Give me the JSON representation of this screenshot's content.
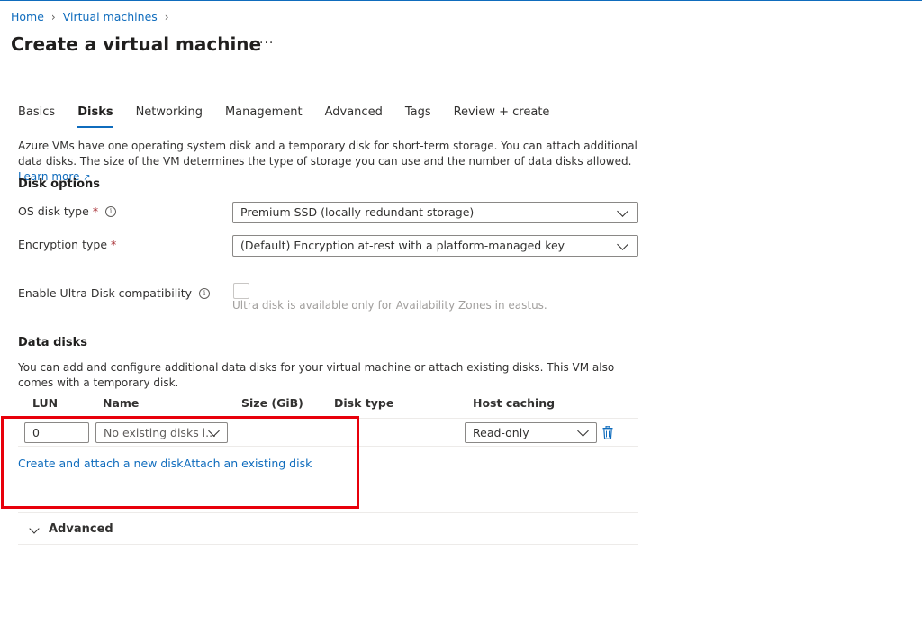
{
  "breadcrumb": {
    "home": "Home",
    "vm": "Virtual machines"
  },
  "page": {
    "title": "Create a virtual machine",
    "more": "···"
  },
  "tabs": [
    {
      "label": "Basics"
    },
    {
      "label": "Disks"
    },
    {
      "label": "Networking"
    },
    {
      "label": "Management"
    },
    {
      "label": "Advanced"
    },
    {
      "label": "Tags"
    },
    {
      "label": "Review + create"
    }
  ],
  "active_tab": "Disks",
  "intro": {
    "text": "Azure VMs have one operating system disk and a temporary disk for short-term storage. You can attach additional data disks. The size of the VM determines the type of storage you can use and the number of data disks allowed.",
    "learn_more": "Learn more"
  },
  "disk_options": {
    "title": "Disk options",
    "os_disk_label": "OS disk type",
    "os_disk_value": "Premium SSD (locally-redundant storage)",
    "encryption_label": "Encryption type",
    "encryption_value": "(Default) Encryption at-rest with a platform-managed key",
    "ultra_label": "Enable Ultra Disk compatibility",
    "ultra_hint": "Ultra disk is available only for Availability Zones in eastus.",
    "required_mark": "*"
  },
  "data_disks": {
    "title": "Data disks",
    "description": "You can add and configure additional data disks for your virtual machine or attach existing disks. This VM also comes with a temporary disk.",
    "columns": [
      "LUN",
      "Name",
      "Size (GiB)",
      "Disk type",
      "Host caching"
    ],
    "row": {
      "lun": "0",
      "name": "No existing disks i...",
      "host_caching": "Read-only"
    },
    "create_link": "Create and attach a new disk",
    "attach_link": "Attach an existing disk"
  },
  "advanced_section": {
    "label": "Advanced"
  },
  "colors": {
    "accent": "#0f6cbd",
    "highlight": "#e8000b",
    "required": "#a4262c"
  }
}
